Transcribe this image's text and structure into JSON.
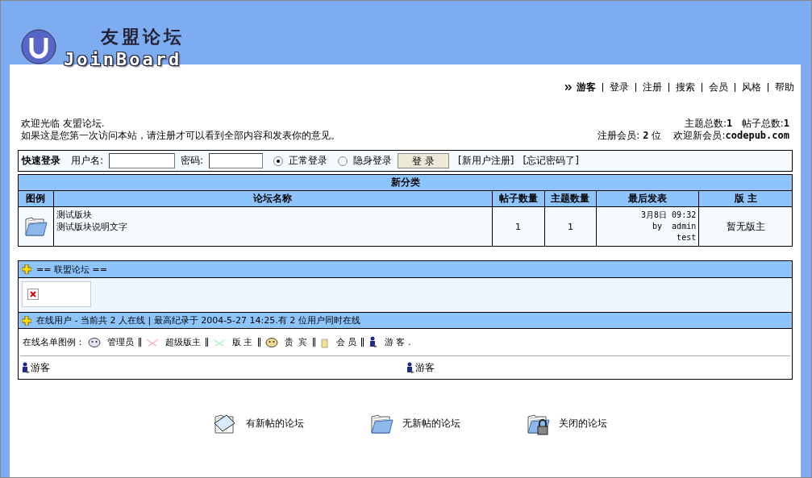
{
  "logo": {
    "title": "友盟论坛",
    "subtitle": "JoinBoard"
  },
  "nav": {
    "user": "游客",
    "links": [
      "登录",
      "注册",
      "搜索",
      "会员",
      "风格",
      "帮助"
    ]
  },
  "welcome": {
    "line1": "欢迎光临 友盟论坛.",
    "line2": "如果这是您第一次访问本站，请注册才可以看到全部内容和发表你的意见。"
  },
  "stats": {
    "topics_label": "主题总数:",
    "topics": "1",
    "posts_label": "帖子总数:",
    "posts": "1",
    "members_label": "注册会员:",
    "members": "2",
    "members_unit": "位",
    "newest_label": "欢迎新会员:",
    "newest": "codepub.com"
  },
  "login": {
    "title": "快速登录",
    "username_label": "用户名:",
    "password_label": "密码:",
    "modes": [
      {
        "label": "正常登录",
        "selected": true
      },
      {
        "label": "隐身登录",
        "selected": false
      }
    ],
    "button": "登 录",
    "links": [
      "[新用户注册]",
      "[忘记密码了]"
    ]
  },
  "category": {
    "title": "新分类",
    "columns": [
      "图例",
      "论坛名称",
      "帖子数量",
      "主题数量",
      "最后发表",
      "版 主"
    ],
    "rows": [
      {
        "name": "测试版块",
        "description": "测试版块说明文字",
        "posts": "1",
        "topics": "1",
        "last_date": "3月8日 09:32",
        "last_by": "by  admin",
        "last_title": "test",
        "moderator": "暂无版主"
      }
    ]
  },
  "alliance": {
    "title": "== 联盟论坛 =="
  },
  "online": {
    "title": "在线用户 - 当前共 2 人在线 | 最高纪录于 2004-5-27 14:25.有 2 位用户同时在线",
    "legend_label": "在线名单图例：",
    "legend": [
      {
        "kind": "admin",
        "label": "管理员"
      },
      {
        "kind": "supermod",
        "label": "超级版主"
      },
      {
        "kind": "mod",
        "label": "版 主"
      },
      {
        "kind": "vip",
        "label": "贵  宾"
      },
      {
        "kind": "member",
        "label": "会 员"
      },
      {
        "kind": "guest",
        "label": "游 客 ."
      }
    ],
    "users": [
      {
        "kind": "guest",
        "name": "游客"
      },
      {
        "kind": "guest",
        "name": "游客"
      }
    ]
  },
  "footer_legend": [
    {
      "kind": "new",
      "label": "有新帖的论坛"
    },
    {
      "kind": "nonew",
      "label": "无新帖的论坛"
    },
    {
      "kind": "closed",
      "label": "关闭的论坛"
    }
  ]
}
